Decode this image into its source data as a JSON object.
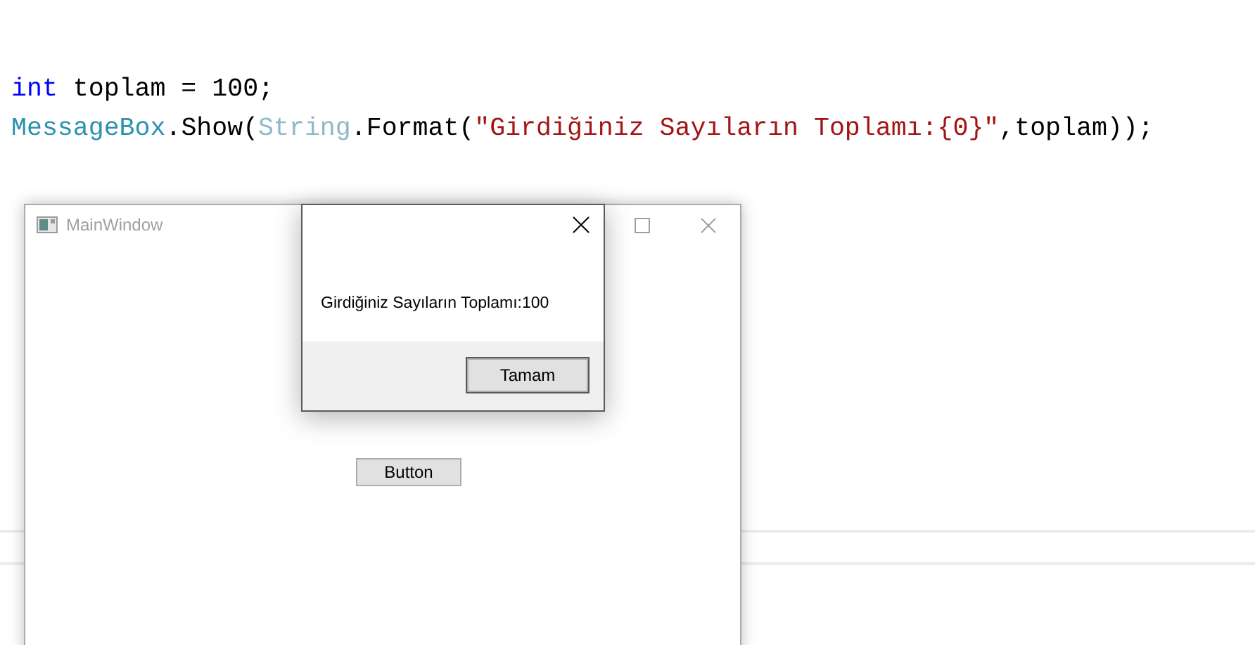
{
  "code": {
    "lines": [
      [
        {
          "text": "int",
          "kind": "keyword"
        },
        {
          "text": " toplam = 100;",
          "kind": "plain"
        }
      ],
      [
        {
          "text": "MessageBox",
          "kind": "type"
        },
        {
          "text": ".Show(",
          "kind": "plain"
        },
        {
          "text": "String",
          "kind": "faded_type"
        },
        {
          "text": ".Format(",
          "kind": "plain"
        },
        {
          "text": "\"Girdiğiniz Sayıların Toplamı:{0}\"",
          "kind": "string"
        },
        {
          "text": ",toplam));",
          "kind": "plain"
        }
      ]
    ]
  },
  "main_window": {
    "title": "MainWindow",
    "button": "Button"
  },
  "message_box": {
    "message": "Girdiğiniz Sayıların Toplamı:100",
    "button": "Tamam"
  }
}
